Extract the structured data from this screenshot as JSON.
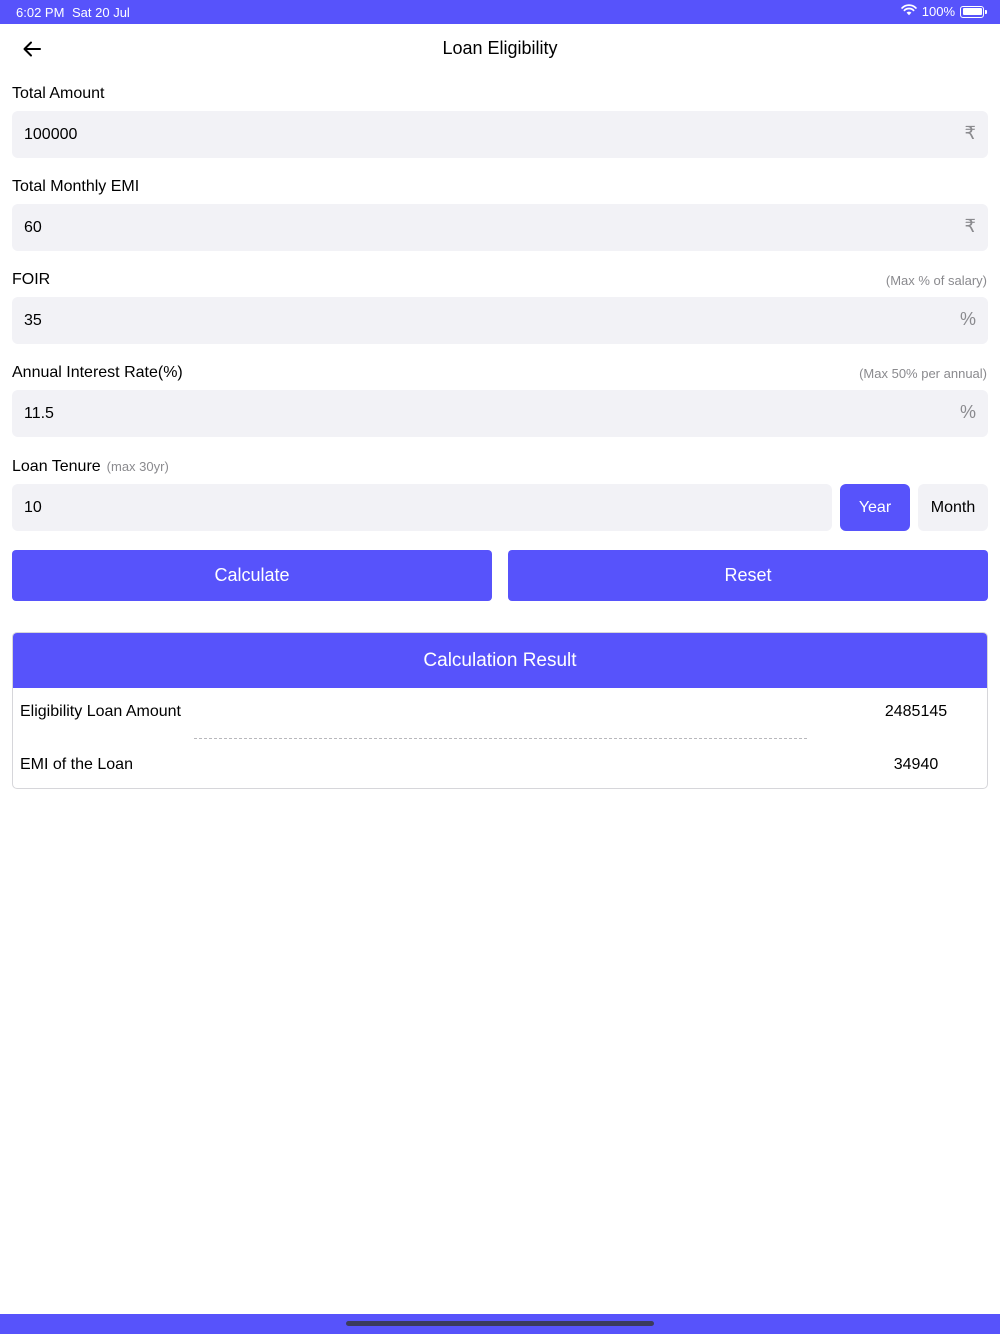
{
  "status_bar": {
    "time": "6:02 PM",
    "date": "Sat 20 Jul",
    "battery": "100%",
    "battery_level": 1.0
  },
  "header": {
    "title": "Loan Eligibility",
    "back_icon": "arrow-left-icon"
  },
  "form": {
    "total_amount": {
      "label": "Total Amount",
      "value": "100000",
      "unit": "₹"
    },
    "monthly_emi": {
      "label": "Total Monthly EMI",
      "value": "60",
      "unit": "₹"
    },
    "foir": {
      "label": "FOIR",
      "hint": "(Max % of salary)",
      "value": "35",
      "unit": "%"
    },
    "interest_rate": {
      "label": "Annual Interest Rate(%)",
      "hint": "(Max 50% per annual)",
      "value": "11.5",
      "unit": "%"
    },
    "tenure": {
      "label": "Loan Tenure",
      "hint": "(max 30yr)",
      "value": "10",
      "options": [
        "Year",
        "Month"
      ],
      "selected": "Year"
    }
  },
  "actions": {
    "calculate": "Calculate",
    "reset": "Reset"
  },
  "result": {
    "title": "Calculation Result",
    "rows": [
      {
        "label": "Eligibility Loan Amount",
        "value": "2485145"
      },
      {
        "label": "EMI of the Loan",
        "value": "34940"
      }
    ]
  },
  "colors": {
    "accent": "#5753fb",
    "field_bg": "#f2f2f6",
    "hint_text": "#8a8a8e"
  }
}
